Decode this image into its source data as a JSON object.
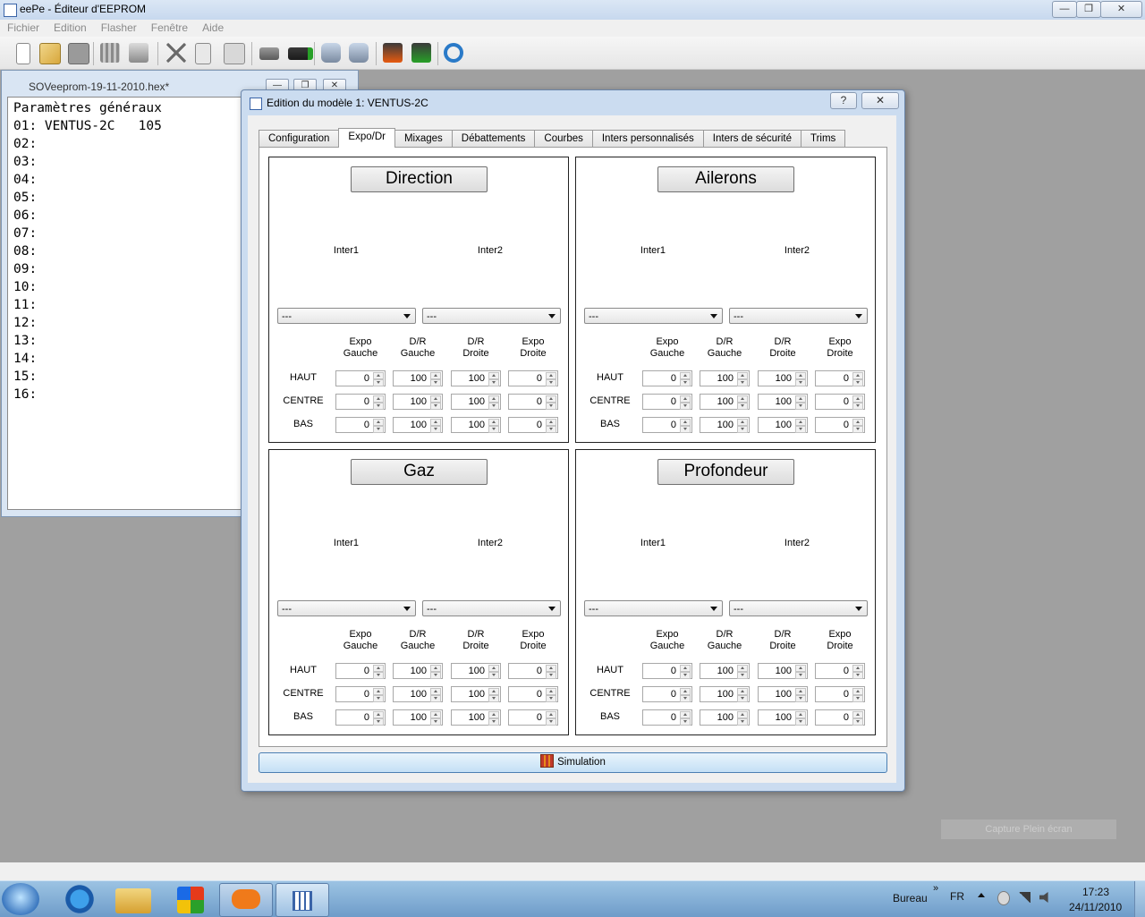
{
  "window": {
    "title": "eePe - Éditeur d'EEPROM",
    "buttons": [
      "—",
      "❐",
      "✕"
    ]
  },
  "menu": [
    "Fichier",
    "Edition",
    "Flasher",
    "Fenêtre",
    "Aide"
  ],
  "toolbar_icons": [
    "new-file-icon",
    "open-file-icon",
    "save-icon",
    "preferences-icon",
    "print-icon",
    "cut-icon",
    "copy-icon",
    "paste-icon",
    "read-eeprom-icon",
    "write-eeprom-icon",
    "read-flash-icon",
    "write-flash-icon",
    "burn-icon",
    "burn-write-icon",
    "settings-icon"
  ],
  "doc": {
    "title": "SOVeeprom-19-11-2010.hex*",
    "buttons": [
      "—",
      "❐",
      "✕"
    ],
    "lines": [
      "Paramètres généraux",
      "01: VENTUS-2C   105",
      "02:",
      "03:",
      "04:",
      "05:",
      "06:",
      "07:",
      "08:",
      "09:",
      "10:",
      "11:",
      "12:",
      "13:",
      "14:",
      "15:",
      "16:"
    ]
  },
  "dialog": {
    "title": "Edition du modèle 1: VENTUS-2C",
    "help": "?",
    "close": "✕",
    "tabs": [
      "Configuration",
      "Expo/Dr",
      "Mixages",
      "Débattements",
      "Courbes",
      "Inters personnalisés",
      "Inters de sécurité",
      "Trims"
    ],
    "active_tab": "Expo/Dr",
    "simulation": "Simulation",
    "column_headers": [
      [
        "Expo",
        "Gauche"
      ],
      [
        "D/R",
        "Gauche"
      ],
      [
        "D/R",
        "Droite"
      ],
      [
        "Expo",
        "Droite"
      ]
    ],
    "row_labels": [
      "HAUT",
      "CENTRE",
      "BAS"
    ],
    "inter_labels": [
      "Inter1",
      "Inter2"
    ],
    "combo_value": "---",
    "groups": [
      {
        "name": "Direction",
        "values": [
          [
            0,
            100,
            100,
            0
          ],
          [
            0,
            100,
            100,
            0
          ],
          [
            0,
            100,
            100,
            0
          ]
        ]
      },
      {
        "name": "Ailerons",
        "values": [
          [
            0,
            100,
            100,
            0
          ],
          [
            0,
            100,
            100,
            0
          ],
          [
            0,
            100,
            100,
            0
          ]
        ]
      },
      {
        "name": "Gaz",
        "values": [
          [
            0,
            100,
            100,
            0
          ],
          [
            0,
            100,
            100,
            0
          ],
          [
            0,
            100,
            100,
            0
          ]
        ]
      },
      {
        "name": "Profondeur",
        "values": [
          [
            0,
            100,
            100,
            0
          ],
          [
            0,
            100,
            100,
            0
          ],
          [
            0,
            100,
            100,
            0
          ]
        ]
      }
    ]
  },
  "taskbar": {
    "items": [
      "start-orb",
      "internet-explorer-icon",
      "explorer-icon",
      "windows-icon",
      "mail-icon",
      "eepe-app-icon"
    ],
    "bureau": "Bureau",
    "chevron": "»",
    "lang": "FR",
    "time": "17:23",
    "date": "24/11/2010",
    "capture": "Capture Plein écran"
  }
}
